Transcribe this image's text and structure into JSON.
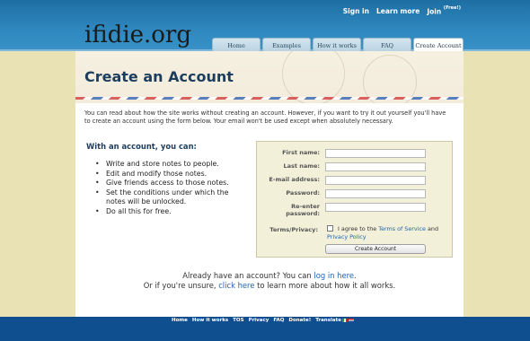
{
  "header": {
    "logo": {
      "part1": "if",
      "part2": "i",
      "part3": "die.org"
    },
    "top_links": {
      "sign_in": "Sign in",
      "learn_more": "Learn more",
      "join": "Join",
      "join_badge": "(Free!)"
    },
    "tabs": [
      {
        "label": "Home",
        "active": false
      },
      {
        "label": "Examples",
        "active": false
      },
      {
        "label": "How it works",
        "active": false
      },
      {
        "label": "FAQ",
        "active": false
      },
      {
        "label": "Create Account",
        "active": true
      }
    ]
  },
  "page": {
    "title": "Create an Account",
    "intro": "You can read about how the site works without creating an account. However, if you want to try it out yourself you'll have to create an account using the form below. Your email won't be used except when absolutely necessary.",
    "benefits_heading": "With an account, you can:",
    "benefits": [
      "Write and store notes to people.",
      "Edit and modify those notes.",
      "Give friends access to those notes.",
      "Set the conditions under which the notes will be unlocked.",
      "Do all this for free."
    ]
  },
  "form": {
    "fields": [
      {
        "label": "First name:",
        "value": ""
      },
      {
        "label": "Last name:",
        "value": ""
      },
      {
        "label": "E-mail address:",
        "value": ""
      },
      {
        "label": "Password:",
        "value": ""
      },
      {
        "label": "Re-enter password:",
        "value": ""
      }
    ],
    "terms_label": "Terms/Privacy:",
    "terms_prefix": "I agree to the",
    "terms_link": "Terms of Service",
    "terms_and": "and",
    "privacy_link": "Privacy Policy",
    "submit": "Create Account"
  },
  "bottom": {
    "line1_prefix": "Already have an account? You can",
    "line1_link": "log in here",
    "line1_suffix": ".",
    "line2_prefix": "Or if you're unsure,",
    "line2_link": "click here",
    "line2_suffix": "to learn more about how it all works."
  },
  "footer": {
    "links": [
      "Home",
      "How it works",
      "TOS",
      "Privacy",
      "FAQ",
      "Donate!"
    ],
    "translate_label": "Translate"
  },
  "colors": {
    "header_blue": "#2d86bd",
    "footer_blue": "#0f4f90",
    "title_navy": "#1d3d5e",
    "link_blue": "#1f63b0",
    "form_bg": "#f3f0da",
    "page_bg": "#e8e2b4"
  }
}
